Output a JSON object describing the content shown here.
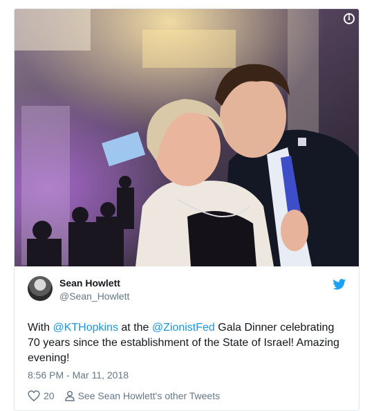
{
  "embed": {
    "info_icon": "info-circle-icon",
    "photo_alt": "Selfie at gala dinner",
    "author": {
      "display_name": "Sean Howlett",
      "handle": "@Sean_Howlett"
    },
    "brand_icon": "twitter-bird-icon",
    "tweet": {
      "text_1": "With ",
      "mention_1": "@KTHopkins",
      "text_2": " at the ",
      "mention_2": "@ZionistFed",
      "text_3": " Gala Dinner celebrating 70 years since the establishment of the State of Israel! Amazing evening!"
    },
    "timestamp": "8:56 PM - Mar 11, 2018",
    "actions": {
      "like_count": "20",
      "see_tweets_label": "See Sean Howlett's other Tweets"
    },
    "colors": {
      "link": "#1b95e0",
      "muted": "#657786",
      "twitter_blue": "#1da1f2"
    }
  }
}
